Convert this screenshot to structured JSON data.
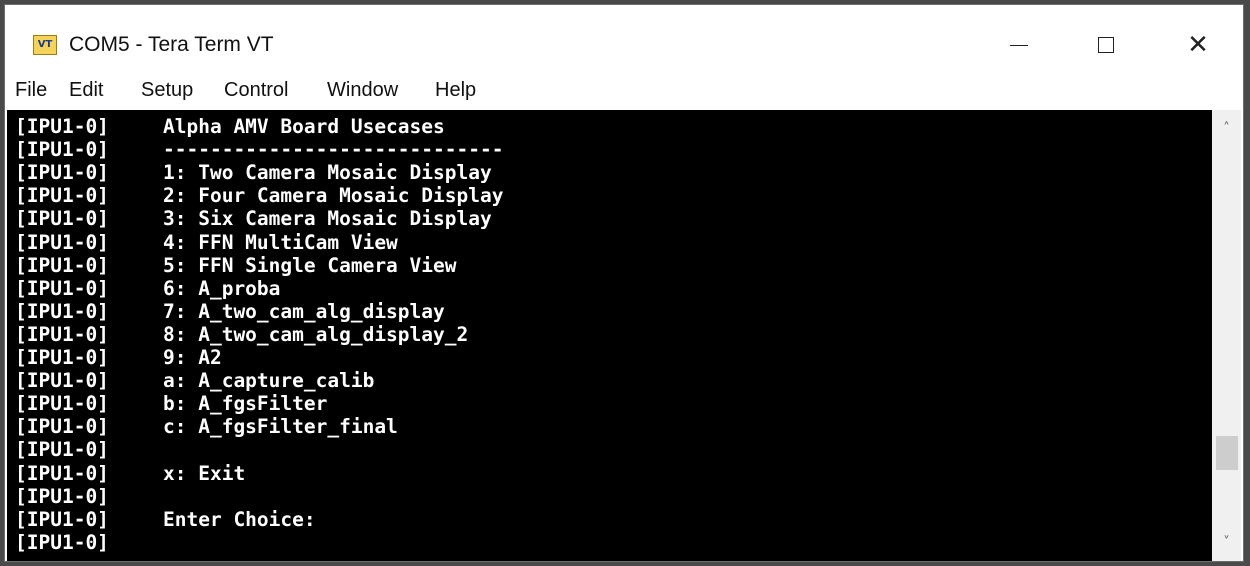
{
  "window": {
    "title": "COM5 - Tera Term VT",
    "icon_label": "VT",
    "controls": {
      "minimize_icon": "minimize-icon",
      "maximize_icon": "maximize-icon",
      "close_icon": "close-icon",
      "close_glyph": "✕"
    }
  },
  "menu": [
    "File",
    "Edit",
    "Setup",
    "Control",
    "Window",
    "Help"
  ],
  "terminal": {
    "background": "#000000",
    "foreground": "#ffffff",
    "prefix": "[IPU1-0]",
    "lines": [
      "Alpha AMV Board Usecases",
      "-----------------------------",
      "1: Two Camera Mosaic Display",
      "2: Four Camera Mosaic Display",
      "3: Six Camera Mosaic Display",
      "4: FFN MultiCam View",
      "5: FFN Single Camera View",
      "6: A_proba",
      "7: A_two_cam_alg_display",
      "8: A_two_cam_alg_display_2",
      "9: A2",
      "a: A_capture_calib",
      "b: A_fgsFilter",
      "c: A_fgsFilter_final",
      "",
      "x: Exit",
      "",
      "Enter Choice:",
      ""
    ]
  },
  "scrollbar": {
    "up_icon": "chevron-up-icon",
    "down_icon": "chevron-down-icon"
  }
}
